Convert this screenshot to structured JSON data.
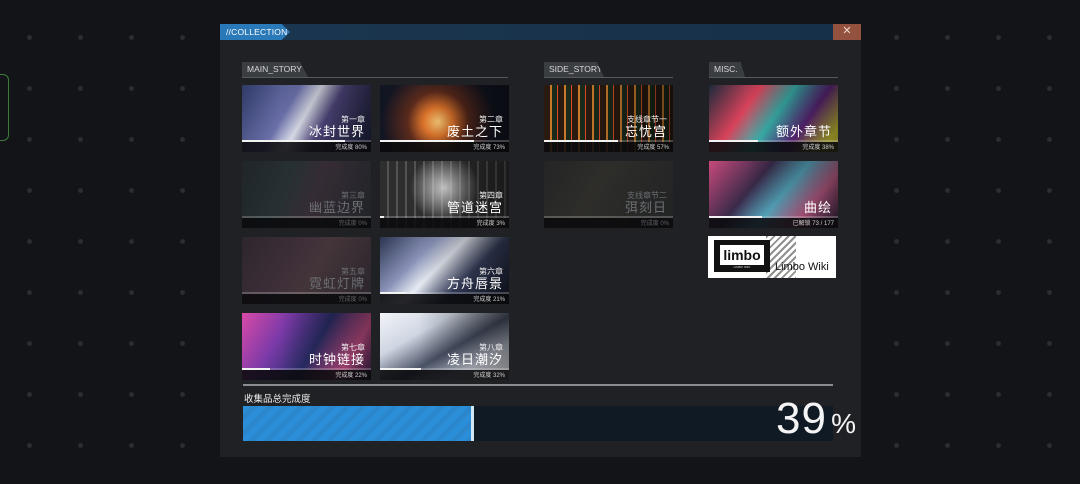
{
  "window": {
    "title": "//COLLECTION",
    "close_symbol": "✕"
  },
  "sections": {
    "main_story": "MAIN_STORY",
    "side_story": "SIDE_STORY",
    "misc": "MISC."
  },
  "cards": [
    {
      "id": "main1",
      "chapter": "第一章",
      "name": "冰封世界",
      "progress_text": "完成度 80%",
      "progress": 0.8,
      "locked": false
    },
    {
      "id": "main2",
      "chapter": "第二章",
      "name": "废土之下",
      "progress_text": "完成度 73%",
      "progress": 0.73,
      "locked": false
    },
    {
      "id": "main3",
      "chapter": "第三章",
      "name": "幽蓝边界",
      "progress_text": "完成度 0%",
      "progress": 0.0,
      "locked": true
    },
    {
      "id": "main4",
      "chapter": "第四章",
      "name": "管道迷宫",
      "progress_text": "完成度 3%",
      "progress": 0.03,
      "locked": false
    },
    {
      "id": "main5",
      "chapter": "第五章",
      "name": "霓虹灯牌",
      "progress_text": "完成度 0%",
      "progress": 0.0,
      "locked": true
    },
    {
      "id": "main6",
      "chapter": "第六章",
      "name": "方舟唇景",
      "progress_text": "完成度 21%",
      "progress": 0.21,
      "locked": false
    },
    {
      "id": "main7",
      "chapter": "第七章",
      "name": "时钟链接",
      "progress_text": "完成度 22%",
      "progress": 0.22,
      "locked": false
    },
    {
      "id": "main8",
      "chapter": "第八章",
      "name": "凌日潮汐",
      "progress_text": "完成度 32%",
      "progress": 0.32,
      "locked": false
    },
    {
      "id": "side1",
      "chapter": "支线章节一",
      "name": "忘忧宫",
      "progress_text": "完成度 57%",
      "progress": 0.57,
      "locked": false
    },
    {
      "id": "side2",
      "chapter": "支线章节二",
      "name": "弭刻日",
      "progress_text": "完成度 0%",
      "progress": 0.0,
      "locked": true
    },
    {
      "id": "misc1",
      "chapter": "",
      "name": "额外章节",
      "progress_text": "完成度 38%",
      "progress": 0.38,
      "locked": false
    },
    {
      "id": "misc2",
      "chapter": "",
      "name": "曲绘",
      "progress_text": "已解锁 73 / 177",
      "progress": 0.41,
      "locked": false
    }
  ],
  "wiki": {
    "logo": "limbo",
    "logo_sub": "LIMBO WIKI",
    "label": "Limbo Wiki"
  },
  "total": {
    "label": "收集品总完成度",
    "value": "39",
    "unit": "%",
    "progress": 0.39
  },
  "colors": {
    "accent_blue": "#2a79b8",
    "bar_blue": "#2a8fd8",
    "close_red": "#93523e",
    "panel_bg": "#1f2124"
  }
}
